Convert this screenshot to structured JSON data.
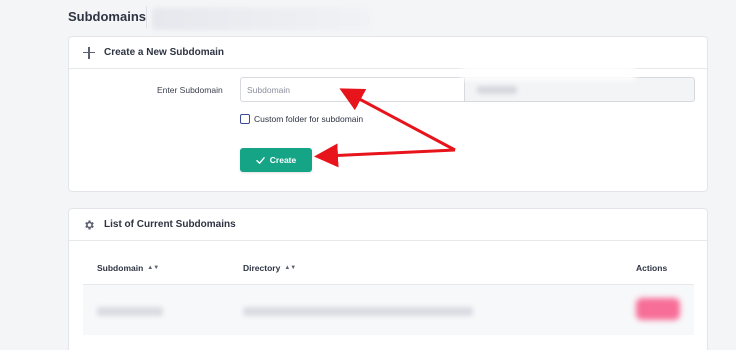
{
  "page": {
    "title": "Subdomains"
  },
  "create_section": {
    "header_title": "Create a New Subdomain",
    "label": "Enter Subdomain",
    "input_placeholder": "Subdomain",
    "input_value": "",
    "checkbox_label": "Custom folder for subdomain",
    "checkbox_checked": false,
    "button_label": "Create"
  },
  "list_section": {
    "header_title": "List of Current Subdomains",
    "columns": [
      "Subdomain",
      "Directory",
      "Actions"
    ]
  },
  "colors": {
    "primary_button": "#16a486",
    "annotation_arrow": "#e8141b",
    "checkbox_border": "#3b4a9a"
  },
  "icons": {
    "create_header": "plus-icon",
    "list_header": "gear-icon",
    "button": "check-icon",
    "sort": "sort-icon"
  }
}
